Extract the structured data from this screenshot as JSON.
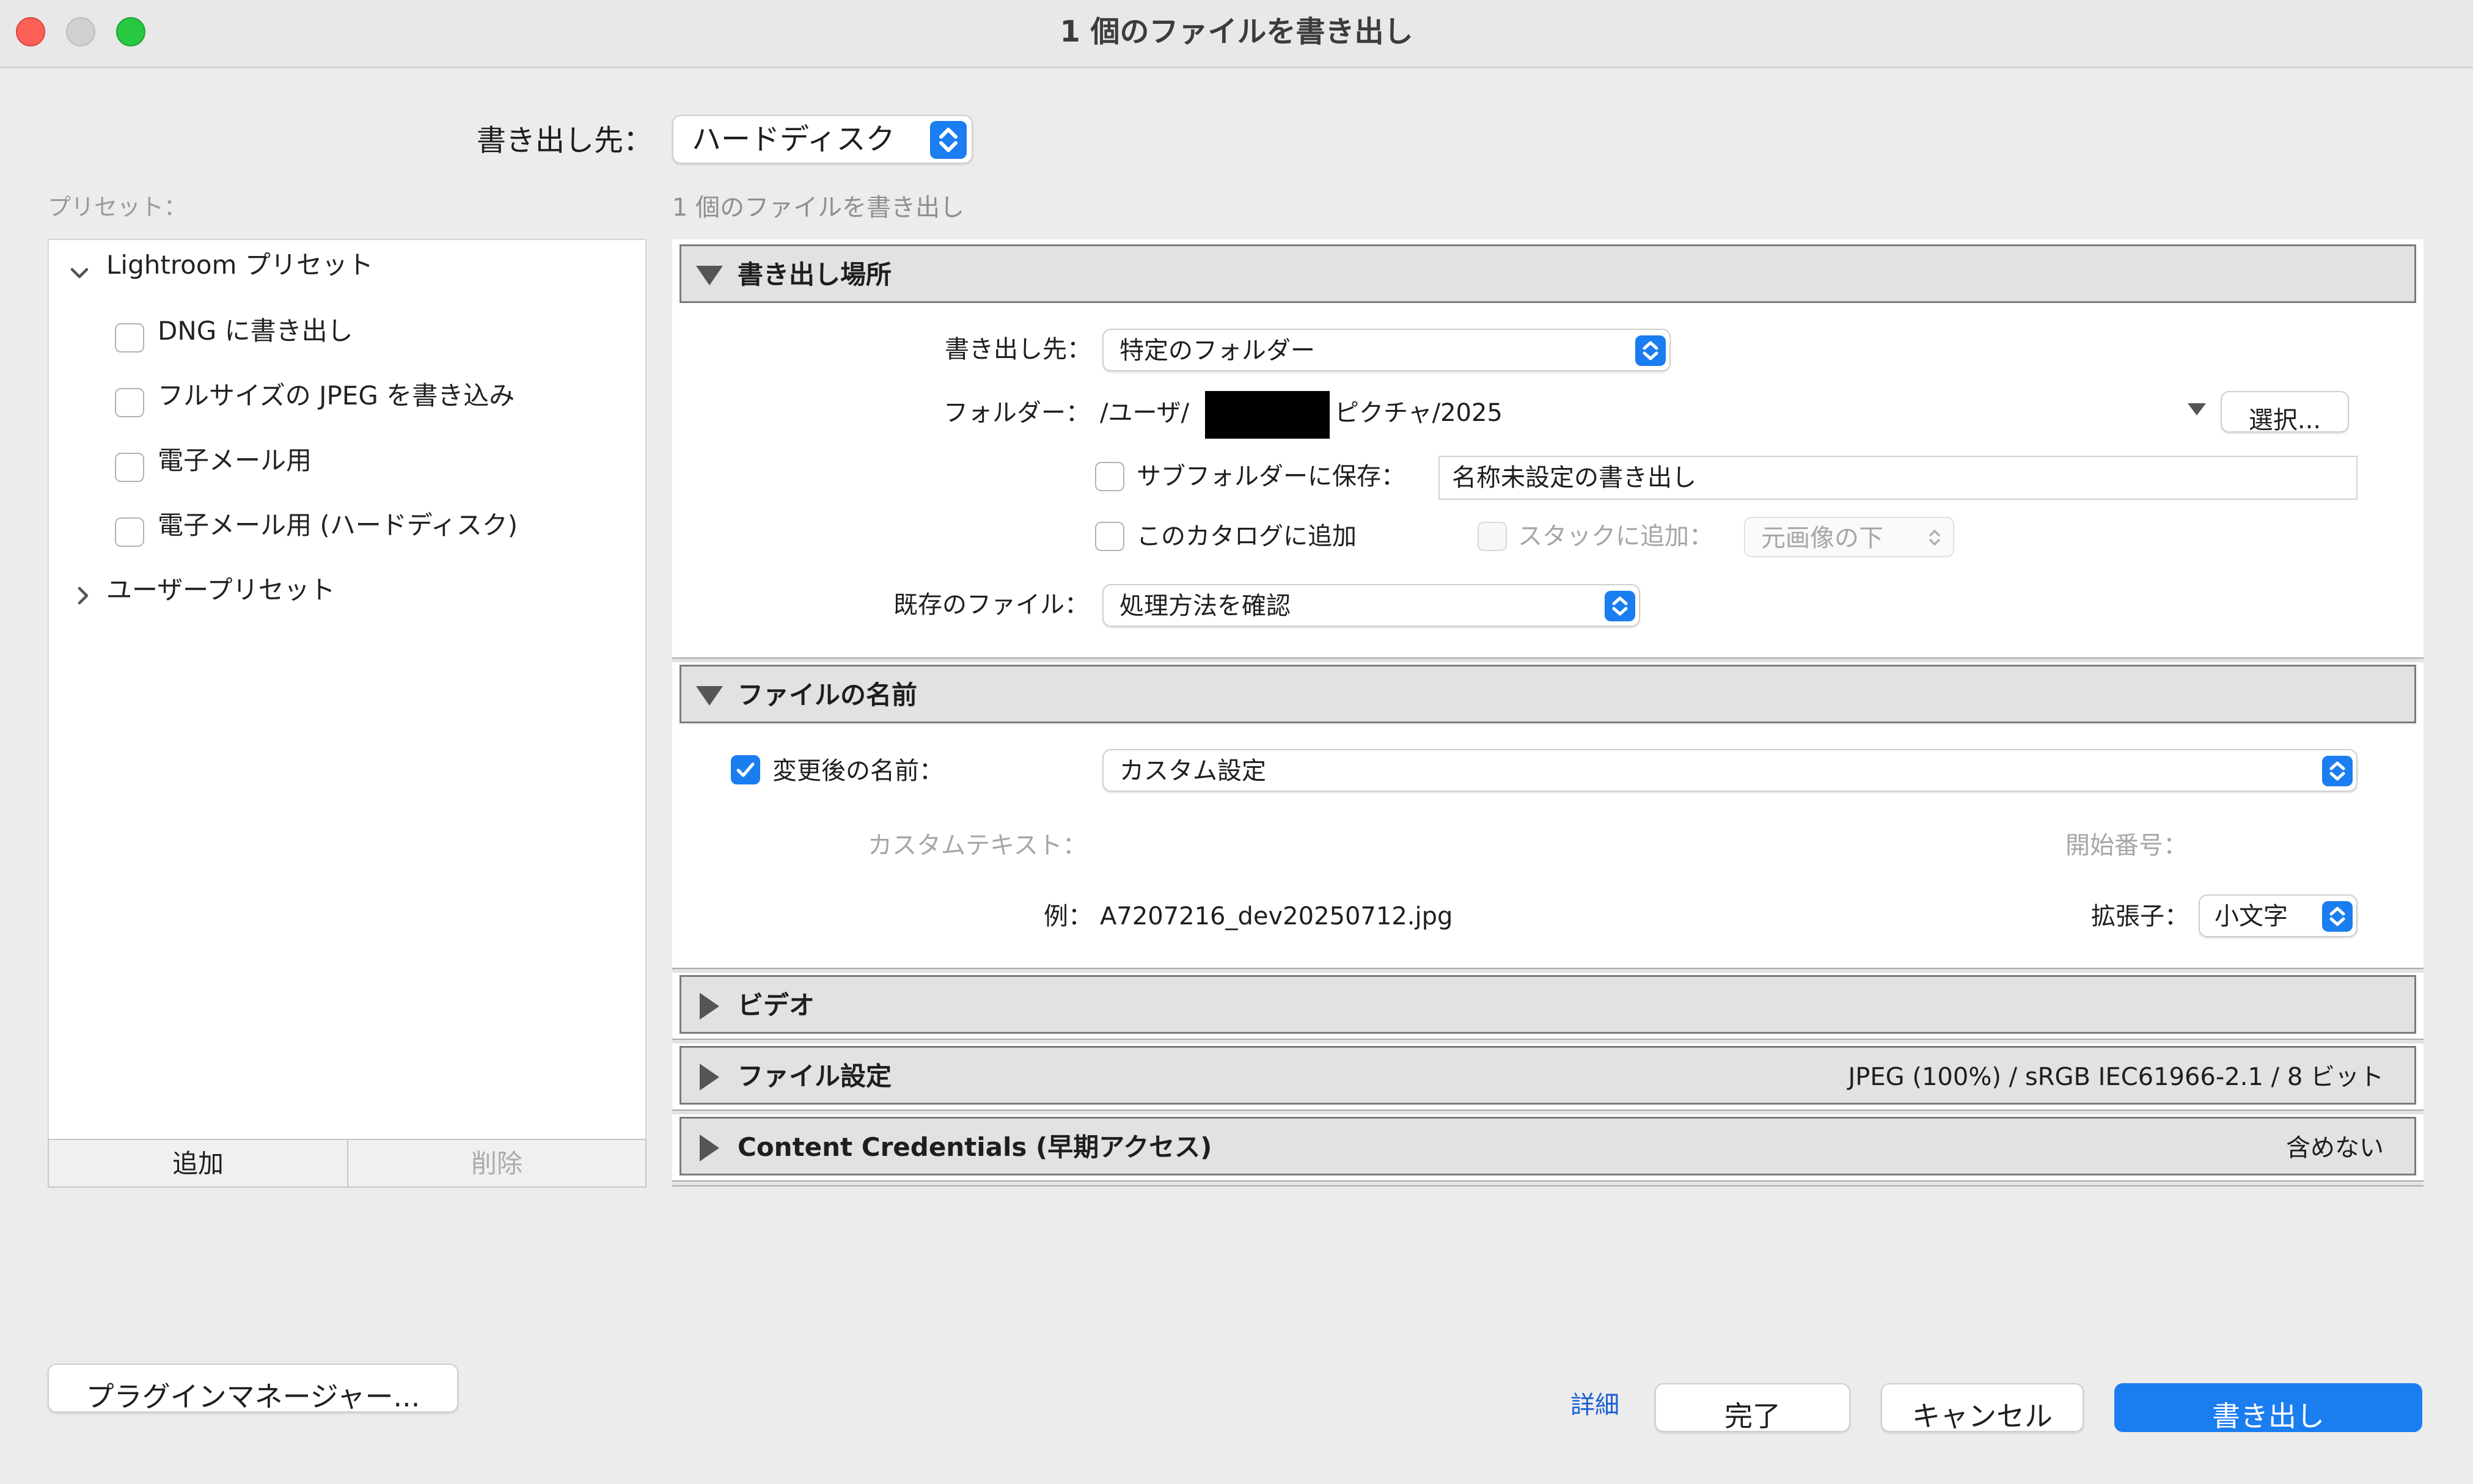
{
  "window": {
    "title": "1 個のファイルを書き出し"
  },
  "export_to": {
    "label": "書き出し先：",
    "value": "ハードディスク"
  },
  "presets": {
    "header": "プリセット：",
    "groups": [
      {
        "label": "Lightroom プリセット",
        "expanded": true,
        "items": [
          "DNG に書き出し",
          "フルサイズの JPEG を書き込み",
          "電子メール用",
          "電子メール用 (ハードディスク)"
        ]
      },
      {
        "label": "ユーザープリセット",
        "expanded": false
      }
    ],
    "add_label": "追加",
    "remove_label": "削除"
  },
  "main": {
    "subtitle": "1 個のファイルを書き出し",
    "location": {
      "title": "書き出し場所",
      "export_to_label": "書き出し先：",
      "export_to_value": "特定のフォルダー",
      "folder_label": "フォルダー：",
      "folder_prefix": "/ユーザ/",
      "folder_suffix": "ピクチャ/2025",
      "choose_label": "選択...",
      "subfolder_label": "サブフォルダーに保存：",
      "subfolder_value": "名称未設定の書き出し",
      "catalog_label": "このカタログに追加",
      "stack_label": "スタックに追加：",
      "stack_value": "元画像の下",
      "existing_label": "既存のファイル：",
      "existing_value": "処理方法を確認"
    },
    "file_naming": {
      "title": "ファイルの名前",
      "rename_label": "変更後の名前：",
      "rename_value": "カスタム設定",
      "custom_text_label": "カスタムテキスト：",
      "start_number_label": "開始番号：",
      "example_label": "例：",
      "example_value": "A7207216_dev20250712.jpg",
      "extension_label": "拡張子：",
      "extension_value": "小文字"
    },
    "video": {
      "title": "ビデオ"
    },
    "file_settings": {
      "title": "ファイル設定",
      "summary": "JPEG (100%) / sRGB IEC61966-2.1 / 8 ビット"
    },
    "content_credentials": {
      "title": "Content Credentials (早期アクセス)",
      "summary": "含めない"
    }
  },
  "footer": {
    "plugin_manager_label": "プラグインマネージャー...",
    "details_label": "詳細",
    "done_label": "完了",
    "cancel_label": "キャンセル",
    "export_label": "書き出し"
  },
  "colors": {
    "accent": "#1a7df0",
    "close": "#fe5f57",
    "minimize": "#d0d0d0",
    "zoom": "#28c840"
  }
}
